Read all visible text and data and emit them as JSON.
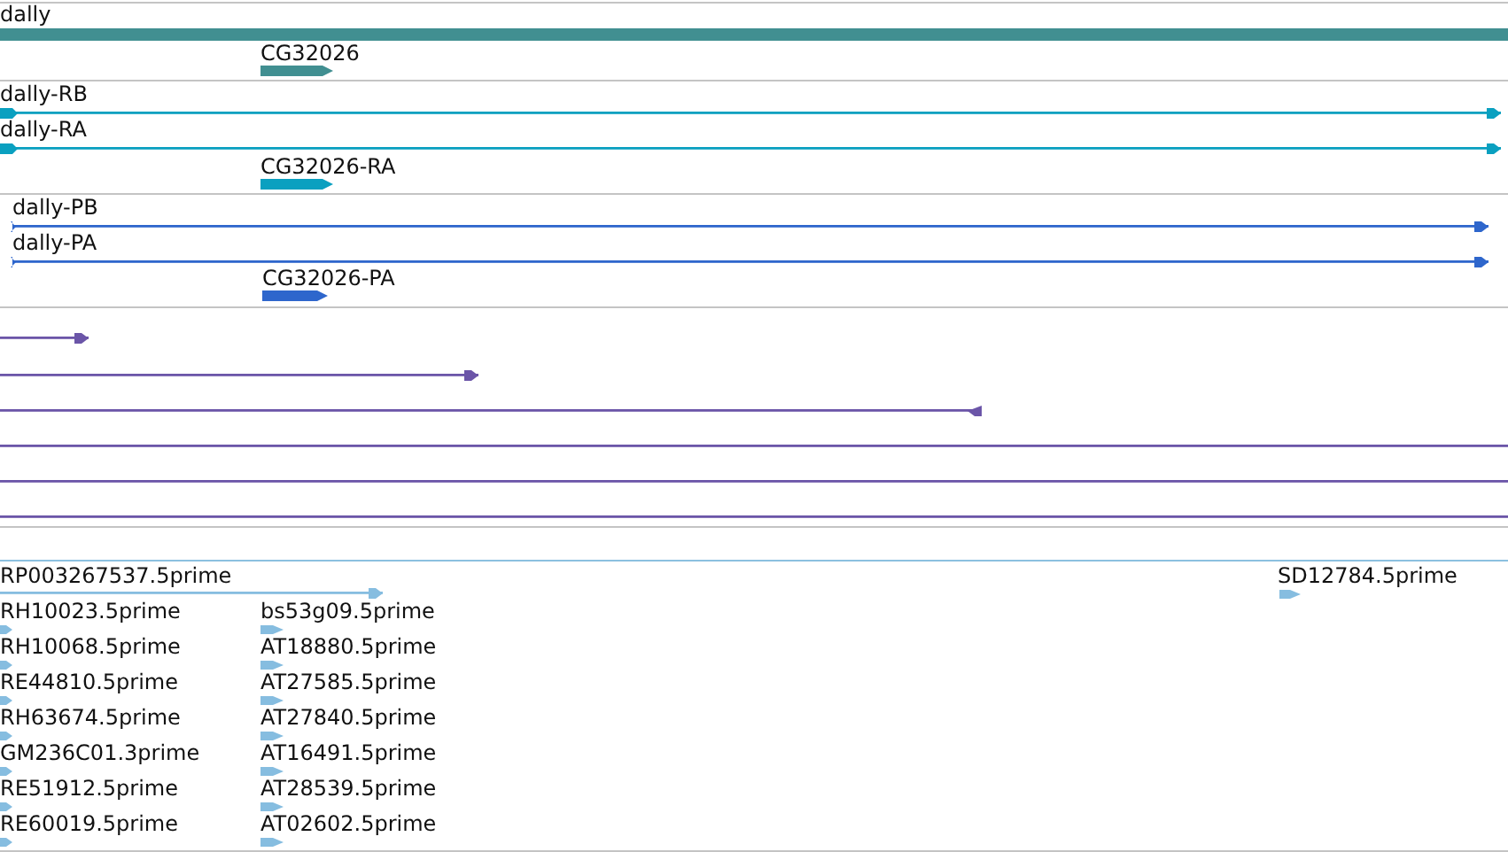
{
  "tracks": [
    {
      "kind": "gene",
      "features": [
        {
          "label": "dally"
        },
        {
          "label": "CG32026",
          "reverse": false
        }
      ]
    },
    {
      "kind": "transcript",
      "features": [
        {
          "label": "dally-RB",
          "reverse": false
        },
        {
          "label": "dally-RA",
          "reverse": false
        },
        {
          "label": "CG32026-RA",
          "reverse": false
        }
      ]
    },
    {
      "kind": "protein",
      "features": [
        {
          "label": "dally-PB",
          "reverse": false
        },
        {
          "label": "dally-PA",
          "reverse": false
        },
        {
          "label": "CG32026-PA",
          "reverse": false
        }
      ]
    },
    {
      "kind": "match",
      "features": [
        {
          "kind": "arrow",
          "reverse": false
        },
        {
          "kind": "arrow",
          "reverse": false
        },
        {
          "kind": "arrow",
          "reverse": true
        },
        {
          "kind": "span"
        },
        {
          "kind": "span"
        },
        {
          "kind": "span"
        }
      ]
    },
    {
      "kind": "spacer"
    },
    {
      "kind": "est",
      "features": [
        {
          "label": "RP003267537.5prime",
          "reverse": false
        },
        {
          "label": "SD12784.5prime",
          "reverse": false
        },
        {
          "label": "RH10023.5prime",
          "reverse": false
        },
        {
          "label": "bs53g09.5prime",
          "reverse": false
        },
        {
          "label": "RH10068.5prime",
          "reverse": false
        },
        {
          "label": "AT18880.5prime",
          "reverse": false
        },
        {
          "label": "RE44810.5prime",
          "reverse": false
        },
        {
          "label": "AT27585.5prime",
          "reverse": false
        },
        {
          "label": "RH63674.5prime",
          "reverse": false
        },
        {
          "label": "AT27840.5prime",
          "reverse": false
        },
        {
          "label": "GM236C01.3prime",
          "reverse": false
        },
        {
          "label": "AT16491.5prime",
          "reverse": false
        },
        {
          "label": "RE51912.5prime",
          "reverse": false
        },
        {
          "label": "AT28539.5prime",
          "reverse": false
        },
        {
          "label": "RE60019.5prime",
          "reverse": false
        },
        {
          "label": "AT02602.5prime",
          "reverse": false
        }
      ]
    }
  ]
}
